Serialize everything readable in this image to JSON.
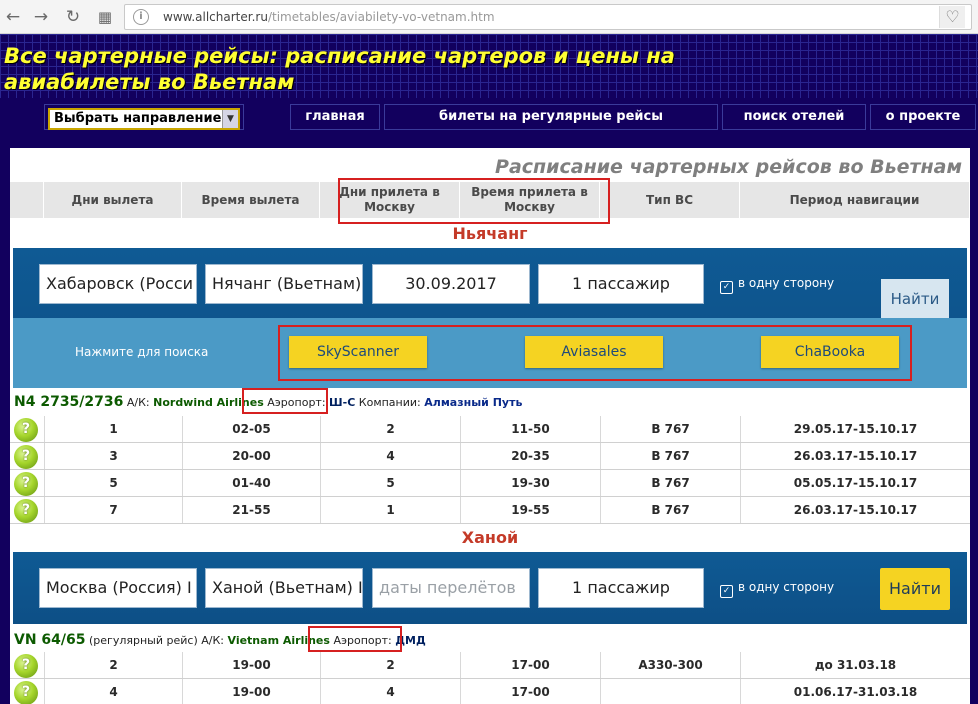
{
  "browser": {
    "url_host": "www.allcharter.ru",
    "url_path": "/timetables/aviabilety-vo-vetnam.htm",
    "back_icon": "arrow-left-icon",
    "forward_icon": "arrow-right-icon",
    "reload_icon": "reload-icon",
    "apps_icon": "apps-grid-icon",
    "bookmark_icon": "heart-icon"
  },
  "site": {
    "title": "Все чартерные рейсы: расписание чартеров и цены на авиабилеты во Вьетнам",
    "menu": {
      "select_value": "Выбрать направление",
      "items": [
        "главная",
        "билеты на регулярные рейсы",
        "поиск отелей",
        "о проекте"
      ]
    }
  },
  "schedule": {
    "title": "Расписание чартерных рейсов во Вьетнам",
    "columns": [
      "Дни вылета",
      "Время вылета",
      "Дни прилета в Москву",
      "Время прилета в Москву",
      "Тип ВС",
      "Период навигации"
    ]
  },
  "sections": [
    {
      "city": "Ньячанг",
      "widget": {
        "from": "Хабаровск (Росси",
        "to": "Нячанг (Вьетнам)",
        "date": "30.09.2017",
        "passengers": "1 пассажир",
        "oneway": "в одну сторону",
        "find": "Найти",
        "hint": "Нажмите для поиска",
        "providers": [
          "SkyScanner",
          "Aviasales",
          "ChaBooka"
        ]
      },
      "flight": {
        "number": "N4 2735/2736",
        "airline_label": "А/К:",
        "airline": "Nordwind Airlines",
        "airport_label": "Аэропорт:",
        "airport": "Ш-С",
        "company_label": "Компании:",
        "company": "Алмазный Путь"
      },
      "rows": [
        [
          "1",
          "02-05",
          "2",
          "11-50",
          "B 767",
          "29.05.17-15.10.17"
        ],
        [
          "3",
          "20-00",
          "4",
          "20-35",
          "B 767",
          "26.03.17-15.10.17"
        ],
        [
          "5",
          "01-40",
          "5",
          "19-30",
          "B 767",
          "05.05.17-15.10.17"
        ],
        [
          "7",
          "21-55",
          "1",
          "19-55",
          "B 767",
          "26.03.17-15.10.17"
        ]
      ]
    },
    {
      "city": "Ханой",
      "widget": {
        "from": "Москва (Россия) I",
        "to": "Ханой (Вьетнам) I",
        "date_placeholder": "даты перелётов",
        "passengers": "1 пассажир",
        "oneway": "в одну сторону",
        "find": "Найти"
      },
      "flight": {
        "number": "VN 64/65",
        "note": "(регулярный рейс)",
        "airline_label": "А/К:",
        "airline": "Vietnam Airlines",
        "airport_label": "Аэропорт:",
        "airport": "ДМД"
      },
      "rows": [
        [
          "2",
          "19-00",
          "2",
          "17-00",
          "A330-300",
          "до 31.03.18"
        ],
        [
          "4",
          "19-00",
          "4",
          "17-00",
          "",
          "01.06.17-31.03.18"
        ]
      ]
    }
  ],
  "colors": {
    "header_bg": "#12005e",
    "title_yellow": "#ffff33",
    "accent_red": "#d62020",
    "button_yellow": "#f5d322",
    "widget_blue": "#0f5a94"
  }
}
